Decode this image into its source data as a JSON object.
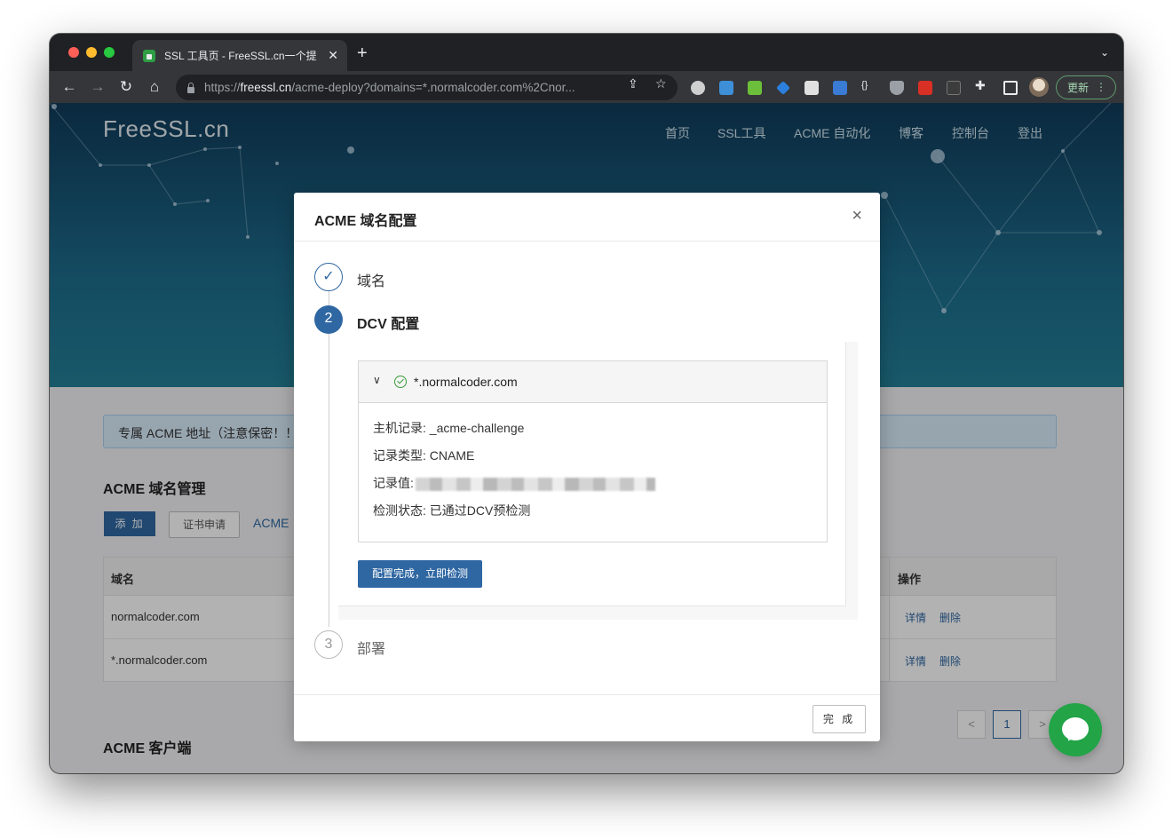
{
  "browser": {
    "tab_title": "SSL 工具页 - FreeSSL.cn一个提",
    "tab_close": "✕",
    "new_tab": "+",
    "url_prefix": "https://",
    "url_domain": "freessl.cn",
    "url_path": "/acme-deploy?domains=*.normalcoder.com%2Cnor...",
    "update_label": "更新"
  },
  "site": {
    "logo": "FreeSSL.cn",
    "nav": [
      "首页",
      "SSL工具",
      "ACME 自动化",
      "博客",
      "控制台",
      "登出"
    ]
  },
  "background": {
    "alert_text": "专属 ACME 地址（注意保密！！",
    "section_title": "ACME 域名管理",
    "add_button": "添 加",
    "cert_button": "证书申请",
    "acme_link": "ACME",
    "table_headers": {
      "domain": "域名",
      "actions": "操作"
    },
    "rows": [
      {
        "domain": "normalcoder.com",
        "detail": "详情",
        "delete": "删除"
      },
      {
        "domain": "*.normalcoder.com",
        "detail": "详情",
        "delete": "删除"
      }
    ],
    "client_title": "ACME 客户端",
    "pager": {
      "prev": "<",
      "current": "1",
      "next": ">"
    }
  },
  "modal": {
    "title": "ACME 域名配置",
    "close": "×",
    "steps": [
      {
        "index": "✓",
        "label": "域名",
        "state": "done"
      },
      {
        "index": "2",
        "label": "DCV 配置",
        "state": "active"
      },
      {
        "index": "3",
        "label": "部署",
        "state": "wait"
      }
    ],
    "dcv": {
      "domain": "*.normalcoder.com",
      "host_record": "主机记录: _acme-challenge",
      "record_type": "记录类型: CNAME",
      "record_value_label": "记录值:",
      "status": "检测状态: 已通过DCV预检测",
      "check_button": "配置完成，立即检测"
    },
    "done_button": "完 成"
  },
  "colors": {
    "primary": "#2f67a2",
    "success": "#3a9b3a",
    "chat": "#22a447"
  }
}
